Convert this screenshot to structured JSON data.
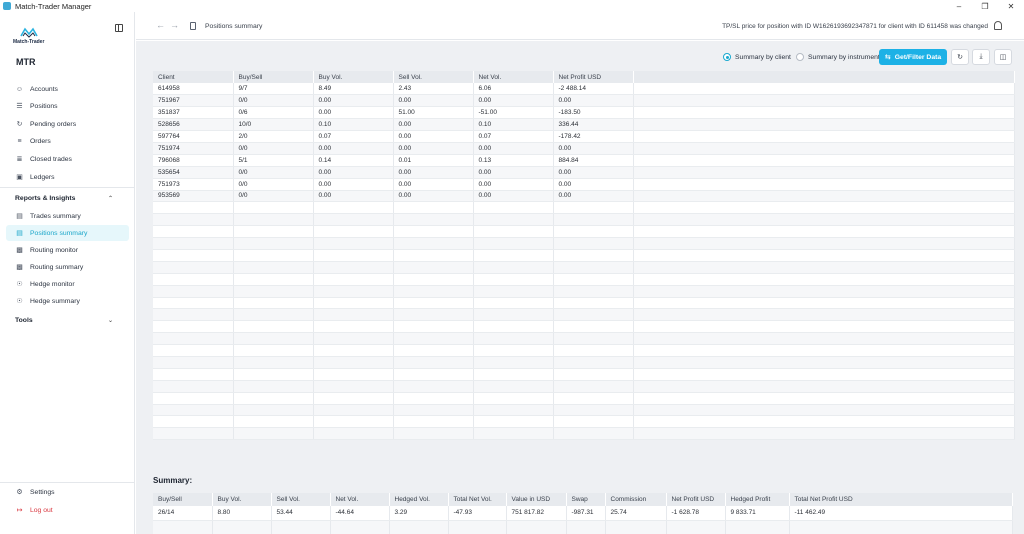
{
  "window": {
    "title": "Match-Trader Manager",
    "controls": [
      "–",
      "❐",
      "✕"
    ]
  },
  "sidebar": {
    "logo_text": "Match-Trader",
    "brand": "MTR",
    "items": [
      {
        "label": "Accounts",
        "icon": "users-icon"
      },
      {
        "label": "Positions",
        "icon": "list-icon"
      },
      {
        "label": "Pending orders",
        "icon": "pending-icon"
      },
      {
        "label": "Orders",
        "icon": "orders-icon"
      },
      {
        "label": "Closed trades",
        "icon": "closed-trades-icon"
      },
      {
        "label": "Ledgers",
        "icon": "ledger-icon"
      }
    ],
    "reports_section": "Reports & Insights",
    "reports_items": [
      {
        "label": "Trades summary",
        "icon": "trades-summary-icon"
      },
      {
        "label": "Positions summary",
        "icon": "positions-summary-icon"
      },
      {
        "label": "Routing monitor",
        "icon": "routing-monitor-icon"
      },
      {
        "label": "Routing summary",
        "icon": "routing-summary-icon"
      },
      {
        "label": "Hedge monitor",
        "icon": "hedge-monitor-icon"
      },
      {
        "label": "Hedge summary",
        "icon": "hedge-summary-icon"
      }
    ],
    "tools_section": "Tools",
    "settings": "Settings",
    "logout": "Log out"
  },
  "header": {
    "breadcrumb": "Positions summary",
    "notice": "TP/SL price for position with ID W1626193692347871 for client with ID 611458 was changed"
  },
  "toolbar": {
    "radio_client": "Summary by client",
    "radio_instrument": "Summary by instrument",
    "primary_button": "Get/Filter Data"
  },
  "table": {
    "columns": [
      "Client",
      "Buy/Sell",
      "Buy Vol.",
      "Sell Vol.",
      "Net Vol.",
      "Net Profit USD"
    ],
    "rows": [
      [
        "614958",
        "9/7",
        "8.49",
        "2.43",
        "6.06",
        "-2 488.14"
      ],
      [
        "751967",
        "0/0",
        "0.00",
        "0.00",
        "0.00",
        "0.00"
      ],
      [
        "351837",
        "0/6",
        "0.00",
        "51.00",
        "-51.00",
        "-183.50"
      ],
      [
        "528656",
        "10/0",
        "0.10",
        "0.00",
        "0.10",
        "336.44"
      ],
      [
        "597764",
        "2/0",
        "0.07",
        "0.00",
        "0.07",
        "-178.42"
      ],
      [
        "751974",
        "0/0",
        "0.00",
        "0.00",
        "0.00",
        "0.00"
      ],
      [
        "796068",
        "5/1",
        "0.14",
        "0.01",
        "0.13",
        "884.84"
      ],
      [
        "535654",
        "0/0",
        "0.00",
        "0.00",
        "0.00",
        "0.00"
      ],
      [
        "751973",
        "0/0",
        "0.00",
        "0.00",
        "0.00",
        "0.00"
      ],
      [
        "953569",
        "0/0",
        "0.00",
        "0.00",
        "0.00",
        "0.00"
      ]
    ]
  },
  "summary": {
    "title": "Summary:",
    "columns": [
      "Buy/Sell",
      "Buy Vol.",
      "Sell Vol.",
      "Net Vol.",
      "Hedged Vol.",
      "Total Net Vol.",
      "Value in USD",
      "Swap",
      "Commission",
      "Net Profit USD",
      "Hedged Profit",
      "Total Net Profit USD"
    ],
    "row": [
      "26/14",
      "8.80",
      "53.44",
      "-44.64",
      "3.29",
      "-47.93",
      "751 817.82",
      "-987.31",
      "25.74",
      "-1 628.78",
      "9 833.71",
      "-11 462.49"
    ]
  }
}
